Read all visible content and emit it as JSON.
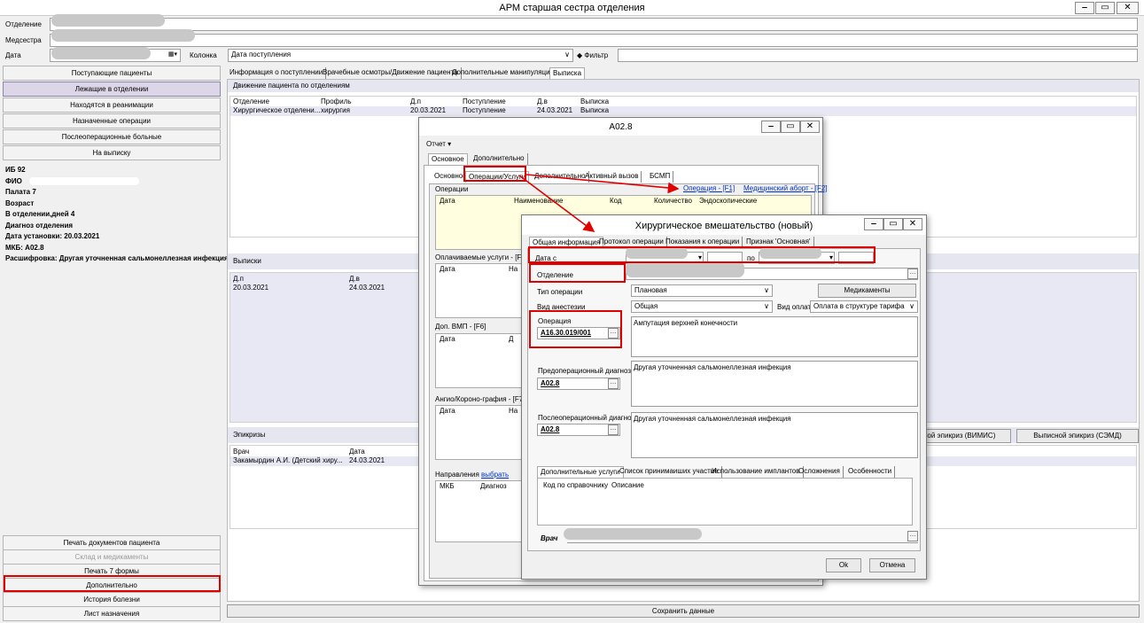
{
  "app": {
    "title": "АРМ старшая сестра отделения",
    "win_buttons": [
      "‒",
      "▭",
      "✕"
    ]
  },
  "top": {
    "otdelenie_label": "Отделение",
    "medsestra_label": "Медсестра",
    "data_label": "Дата",
    "kolonka_label": "Колонка",
    "kolonka_value": "Дата поступления",
    "filter_label": "Фильтр"
  },
  "nav": [
    "Поступающие пациенты",
    "Лежащие в отделении",
    "Находятся в реанимации",
    "Назначенные операции",
    "Послеоперационные больные",
    "На выписку"
  ],
  "patient": {
    "ib": "ИБ 92",
    "fio": "ФИО",
    "palata": "Палата 7",
    "vozrast": "Возраст",
    "days": "В отделении,дней 4",
    "diag": "Диагноз отделения",
    "date_set": "Дата установки: 20.03.2021",
    "mkb": "МКБ: A02.8",
    "rasshifr": "Расшифровка: Другая уточненная сальмонеллезная инфекция"
  },
  "bottom_nav": [
    "Печать документов пациента",
    "Склад и медикаменты",
    "Печать 7 формы",
    "Дополнительно",
    "История болезни",
    "Лист назначения"
  ],
  "main": {
    "tabs": [
      "Информация о поступлении",
      "Врачебные осмотры/Движение пациента",
      "Дополнительные манипуляции",
      "Выписка"
    ],
    "movement_title": "Движение пациента по отделениям",
    "movement_headers": [
      "Отделение",
      "Профиль",
      "Д.п",
      "Поступление",
      "Д.в",
      "Выписка"
    ],
    "movement_row": [
      "Хирургическое отделени...",
      "хирургия",
      "20.03.2021",
      "Поступление",
      "24.03.2021",
      "Выписка"
    ],
    "vypiski_title": "Выписки",
    "vypiski_headers": [
      "Д.п",
      "Д.в"
    ],
    "vypiski_row": [
      "20.03.2021",
      "24.03.2021"
    ],
    "epikrizy_title": "Эпикризы",
    "epikrizy_headers": [
      "Врач",
      "Дата"
    ],
    "epikrizy_row": [
      "Закамырдин А.И. (Детский хиру...",
      "24.03.2021"
    ],
    "epikriz_vimis": "ной эпикриз (ВИМИС)",
    "epikriz_semd": "Выписной эпикриз (СЭМД)",
    "save": "Сохранить данные"
  },
  "win_a": {
    "title": "A02.8",
    "menu": "Отчет ▾",
    "tabs": [
      "Основное",
      "Дополнительно"
    ],
    "subtabs": [
      "Основное",
      "Операции/Услуги",
      "Дополнительно",
      "Активный вызов",
      "БСМП"
    ],
    "operacii_label": "Операции",
    "link_op": "Операция - [F1]",
    "link_abort": "Медицинский аборт - [F2]",
    "op_headers": [
      "Дата",
      "Наименование",
      "Код",
      "Количество",
      "Эндоскопические"
    ],
    "paid_label": "Оплачиваемые услуги - [F3]",
    "paid_headers": [
      "Дата",
      "На"
    ],
    "vmp_label": "Доп. ВМП - [F6]",
    "vmp_headers": [
      "Дата",
      "Д"
    ],
    "angio_label": "Ангио/Короно-графия - [F7]",
    "angio_headers": [
      "Дата",
      "На"
    ],
    "napr_label": "Направления",
    "napr_link": "выбрать",
    "napr_headers": [
      "МКБ",
      "Диагноз"
    ]
  },
  "win_b": {
    "title": "Хирургическое вмешательство (новый)",
    "tabs": [
      "Общая информация",
      "Протокол операции",
      "Показания к операции",
      "Признак 'Основная'"
    ],
    "date_from": "Дата с",
    "date_to": "по",
    "otdelenie": "Отделение",
    "tip_label": "Тип операции",
    "tip_value": "Плановая",
    "medikamenty": "Медикаменты",
    "anest_label": "Вид анестезии",
    "anest_value": "Общая",
    "oplata_label": "Вид оплаты",
    "oplata_value": "Оплата в структуре тарифа",
    "operacia_label": "Операция",
    "operacia_code": "A16.30.019/001",
    "operacia_name": "Ампутация верхней конечности",
    "preop_label": "Предоперационный диагноз",
    "preop_code": "A02.8",
    "preop_text": "Другая уточненная сальмонеллезная инфекция",
    "postop_label": "Послеоперационный диагноз",
    "postop_code": "A02.8",
    "postop_text": "Другая уточненная сальмонеллезная инфекция",
    "subtabs": [
      "Дополнительные услуги",
      "Список принимаиших участие",
      "Использование имплантов",
      "Осложнения",
      "Особенности"
    ],
    "sub_headers": [
      "Код по справочнику",
      "Описание"
    ],
    "vrach_label": "Врач",
    "ok": "Ok",
    "cancel": "Отмена"
  },
  "colors": {
    "highlight": "#e00000",
    "accent": "#5a5aa0",
    "selected_nav": "#dcd6e8",
    "header_bg": "#e6e6f0"
  }
}
